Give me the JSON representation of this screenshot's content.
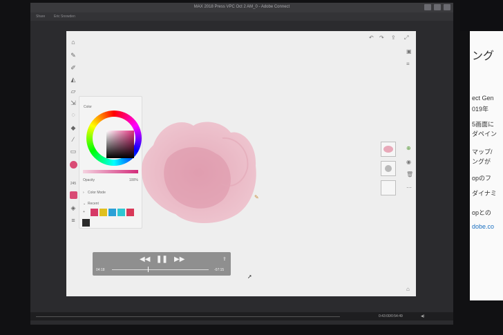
{
  "window": {
    "title": "MAX 2018 Press VPC Oct 2 AM_0 - Adobe Connect",
    "tab_items": [
      "Share",
      "Eric Snowden"
    ]
  },
  "app": {
    "toolbar_icons": [
      "home-icon",
      "brush-icon",
      "pencil-icon",
      "fill-icon",
      "eraser-icon",
      "select-icon",
      "lasso-icon",
      "paint-bucket-icon",
      "eyedropper-icon",
      "image-icon",
      "layers-icon"
    ],
    "color_panel": {
      "title": "Color",
      "opacity_label": "Opacity",
      "opacity_value": "100%",
      "color_mode_label": "Color Mode",
      "recent_label": "Recent",
      "selected_color": "#d94a74",
      "recent_colors": [
        "#d63a67",
        "#e0c020",
        "#2ba0d6",
        "#2fc6d3",
        "#d83858"
      ],
      "extra_color": "#2a2a2a"
    },
    "top_right_icons": [
      "undo-icon",
      "redo-icon",
      "share-icon",
      "fullscreen-icon"
    ],
    "right_rail_icons": [
      "add-layer-icon",
      "visibility-icon",
      "delete-icon",
      "more-icon"
    ]
  },
  "video": {
    "elapsed": "04:18",
    "remaining": "-07:15",
    "progress": 0.37
  },
  "status": {
    "time": "0:43:00/0:54:49"
  },
  "side_slide": {
    "lines": [
      "ング",
      "ect Gen",
      "019年",
      "5画面に",
      "ダペイン",
      "マップ/",
      "ングが",
      "opのフ",
      "ダイナミ",
      "opとの",
      "dobe.co"
    ]
  }
}
